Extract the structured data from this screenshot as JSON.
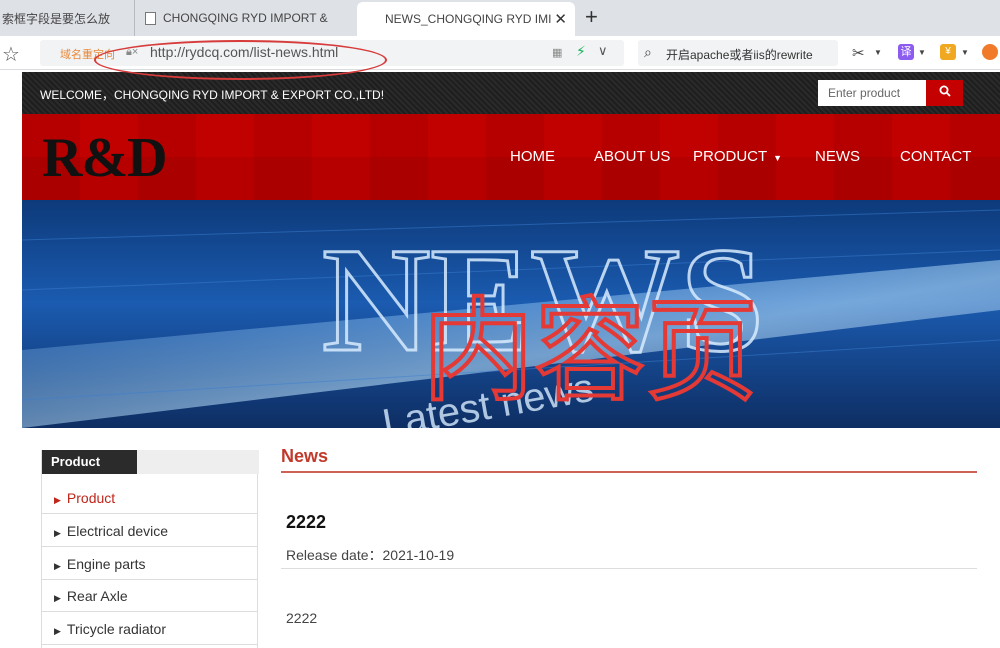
{
  "browser": {
    "tabs": [
      {
        "label": "索框字段是要怎么放"
      },
      {
        "label": "CHONGQING RYD IMPORT &"
      },
      {
        "label": "NEWS_CHONGQING RYD IMI"
      }
    ],
    "new_tab": "+",
    "close_tab": "✕",
    "url_hint": "域名重定向",
    "url": "http://rydcq.com/list-news.html",
    "search_text": "开启apache或者iis的rewrite",
    "translate_ext": "译",
    "yuan_ext": "¥"
  },
  "site": {
    "welcome": "WELCOME，CHONGQING RYD IMPORT & EXPORT CO.,LTD!",
    "search_placeholder": "Enter product",
    "logo": "R&D",
    "nav": [
      {
        "label": "HOME"
      },
      {
        "label": "ABOUT US"
      },
      {
        "label": "PRODUCT"
      },
      {
        "label": "NEWS"
      },
      {
        "label": "CONTACT"
      }
    ],
    "banner": {
      "big_word": "NEWS",
      "sub_word": "Latest news",
      "overlay_handwriting": "内容页"
    },
    "sidebar": {
      "heading": "Product",
      "items": [
        {
          "label": "Product"
        },
        {
          "label": "Electrical device"
        },
        {
          "label": "Engine parts"
        },
        {
          "label": "Rear Axle"
        },
        {
          "label": "Tricycle radiator"
        }
      ]
    },
    "main": {
      "section_title": "News",
      "article_title": "2222",
      "release_date": "Release date：2021-10-19",
      "body": "2222"
    }
  },
  "colors": {
    "brand_red": "#c10000",
    "accent_red": "#c1392b",
    "annotation_red": "#e53935"
  }
}
